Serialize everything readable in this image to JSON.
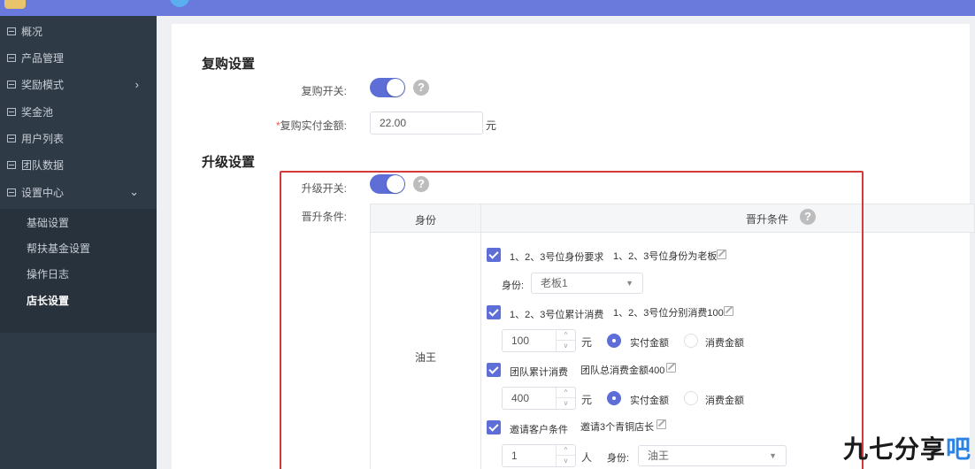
{
  "sidebar": {
    "items": [
      {
        "label": "概况"
      },
      {
        "label": "产品管理"
      },
      {
        "label": "奖励模式"
      },
      {
        "label": "奖金池"
      },
      {
        "label": "用户列表"
      },
      {
        "label": "团队数据"
      },
      {
        "label": "设置中心"
      }
    ],
    "sub_items": [
      {
        "label": "基础设置"
      },
      {
        "label": "帮扶基金设置"
      },
      {
        "label": "操作日志"
      },
      {
        "label": "店长设置"
      }
    ]
  },
  "repurchase": {
    "title": "复购设置",
    "switch_label": "复购开关:",
    "amount_label": "复购实付金额:",
    "amount_value": "22.00",
    "amount_unit": "元"
  },
  "upgrade": {
    "title": "升级设置",
    "switch_label": "升级开关:",
    "condition_label": "晋升条件:",
    "col_identity": "身份",
    "col_condition": "晋升条件",
    "row_identity": "油王",
    "conditions": [
      {
        "label": "1、2、3号位身份要求",
        "desc": "1、2、3号位身份为老板"
      },
      {
        "label": "1、2、3号位累计消费",
        "desc": "1、2、3号位分别消费100"
      },
      {
        "label": "团队累计消费",
        "desc": "团队总消费金额400"
      },
      {
        "label": "邀请客户条件",
        "desc": "邀请3个青铜店长"
      }
    ],
    "identity_select_label": "身份:",
    "identity_select_value": "老板1",
    "consume_value_1": "100",
    "consume_value_2": "400",
    "unit_yuan": "元",
    "radio_paid": "实付金额",
    "radio_consume": "消费金额",
    "invite_count": "1",
    "invite_unit": "人",
    "invite_identity_label": "身份:",
    "invite_identity_value": "油王"
  },
  "watermark": {
    "main": "九七分享",
    "tail": "吧"
  },
  "icons": {
    "help": "?",
    "chevron_right": "›",
    "chevron_down": "⌄",
    "select_arrow": "▼",
    "step_up": "^",
    "step_down": "v"
  },
  "colors": {
    "accent": "#5d6fd6",
    "topbar": "#6a79dc",
    "sidebar": "#2f3a47",
    "highlight_box": "#d43a3a"
  }
}
